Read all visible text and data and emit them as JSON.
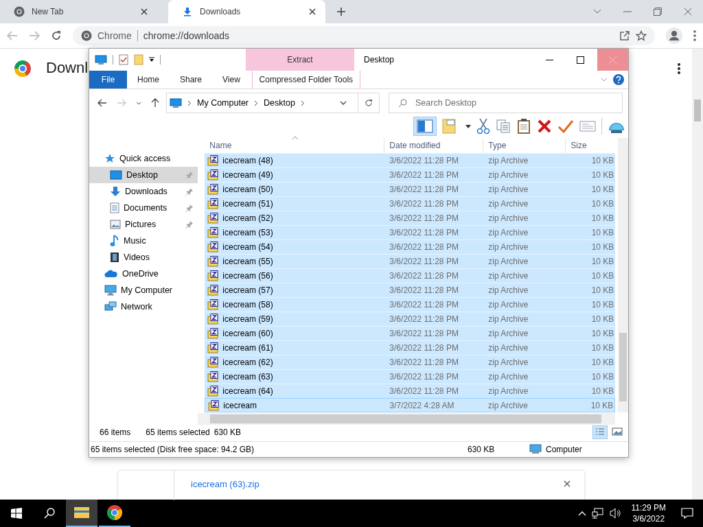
{
  "browser": {
    "tabs": [
      {
        "title": "New Tab",
        "selected": false
      },
      {
        "title": "Downloads",
        "selected": true
      }
    ],
    "omnibox": {
      "site": "Chrome",
      "url": "chrome://downloads"
    },
    "page_title": "Downl",
    "download_item": {
      "file": "icecream (63).zip"
    }
  },
  "explorer": {
    "context_tab": "Extract",
    "window_title": "Desktop",
    "ribbon_tabs": [
      {
        "label": "File",
        "kind": "file"
      },
      {
        "label": "Home",
        "kind": "tab"
      },
      {
        "label": "Share",
        "kind": "tab"
      },
      {
        "label": "View",
        "kind": "tab"
      },
      {
        "label": "Compressed Folder Tools",
        "kind": "context"
      }
    ],
    "address": {
      "segments": [
        "My Computer",
        "Desktop"
      ]
    },
    "search": {
      "placeholder": "Search Desktop"
    },
    "nav": [
      {
        "label": "Quick access",
        "selected": false,
        "children": [
          {
            "label": "Desktop",
            "selected": true,
            "pinned": true
          },
          {
            "label": "Downloads",
            "selected": false,
            "pinned": true
          },
          {
            "label": "Documents",
            "selected": false,
            "pinned": true
          },
          {
            "label": "Pictures",
            "selected": false,
            "pinned": true
          },
          {
            "label": "Music",
            "selected": false,
            "pinned": false
          },
          {
            "label": "Videos",
            "selected": false,
            "pinned": false
          }
        ]
      },
      {
        "label": "OneDrive",
        "selected": false
      },
      {
        "label": "My Computer",
        "selected": false
      },
      {
        "label": "Network",
        "selected": false
      }
    ],
    "columns": [
      "Name",
      "Date modified",
      "Type",
      "Size"
    ],
    "rows": [
      {
        "name": "icecream (48)",
        "date": "3/6/2022 11:28 PM",
        "type": "zip Archive",
        "size": "10 KB",
        "selected": true
      },
      {
        "name": "icecream (49)",
        "date": "3/6/2022 11:28 PM",
        "type": "zip Archive",
        "size": "10 KB",
        "selected": true
      },
      {
        "name": "icecream (50)",
        "date": "3/6/2022 11:28 PM",
        "type": "zip Archive",
        "size": "10 KB",
        "selected": true
      },
      {
        "name": "icecream (51)",
        "date": "3/6/2022 11:28 PM",
        "type": "zip Archive",
        "size": "10 KB",
        "selected": true
      },
      {
        "name": "icecream (52)",
        "date": "3/6/2022 11:28 PM",
        "type": "zip Archive",
        "size": "10 KB",
        "selected": true
      },
      {
        "name": "icecream (53)",
        "date": "3/6/2022 11:28 PM",
        "type": "zip Archive",
        "size": "10 KB",
        "selected": true
      },
      {
        "name": "icecream (54)",
        "date": "3/6/2022 11:28 PM",
        "type": "zip Archive",
        "size": "10 KB",
        "selected": true
      },
      {
        "name": "icecream (55)",
        "date": "3/6/2022 11:28 PM",
        "type": "zip Archive",
        "size": "10 KB",
        "selected": true
      },
      {
        "name": "icecream (56)",
        "date": "3/6/2022 11:28 PM",
        "type": "zip Archive",
        "size": "10 KB",
        "selected": true
      },
      {
        "name": "icecream (57)",
        "date": "3/6/2022 11:28 PM",
        "type": "zip Archive",
        "size": "10 KB",
        "selected": true
      },
      {
        "name": "icecream (58)",
        "date": "3/6/2022 11:28 PM",
        "type": "zip Archive",
        "size": "10 KB",
        "selected": true
      },
      {
        "name": "icecream (59)",
        "date": "3/6/2022 11:28 PM",
        "type": "zip Archive",
        "size": "10 KB",
        "selected": true
      },
      {
        "name": "icecream (60)",
        "date": "3/6/2022 11:28 PM",
        "type": "zip Archive",
        "size": "10 KB",
        "selected": true
      },
      {
        "name": "icecream (61)",
        "date": "3/6/2022 11:28 PM",
        "type": "zip Archive",
        "size": "10 KB",
        "selected": true
      },
      {
        "name": "icecream (62)",
        "date": "3/6/2022 11:28 PM",
        "type": "zip Archive",
        "size": "10 KB",
        "selected": true
      },
      {
        "name": "icecream (63)",
        "date": "3/6/2022 11:28 PM",
        "type": "zip Archive",
        "size": "10 KB",
        "selected": true
      },
      {
        "name": "icecream (64)",
        "date": "3/6/2022 11:28 PM",
        "type": "zip Archive",
        "size": "10 KB",
        "selected": true
      },
      {
        "name": "icecream",
        "date": "3/7/2022 4:28 AM",
        "type": "zip Archive",
        "size": "10 KB",
        "selected": true
      }
    ],
    "item_count": "66 items",
    "selection_info": "65 items selected",
    "selection_size": "630 KB",
    "status_bar": {
      "text": "65 items selected (Disk free space: 94.2 GB)",
      "size": "630 KB",
      "location": "Computer"
    }
  },
  "taskbar": {
    "apps": [
      {
        "kind": "explorer",
        "selected": true,
        "running": true
      },
      {
        "kind": "chrome",
        "selected": false,
        "running": true
      }
    ],
    "time": "11:29 PM",
    "date": "3/6/2022"
  }
}
